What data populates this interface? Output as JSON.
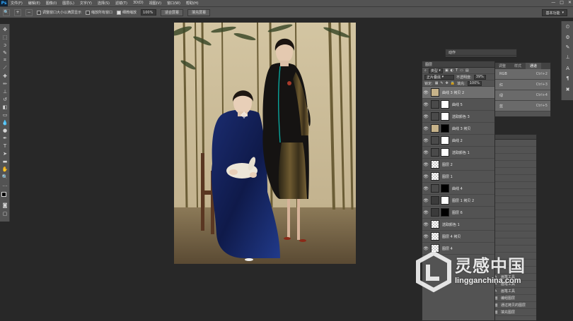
{
  "app": {
    "logo": "Ps"
  },
  "menu": [
    "文件(F)",
    "编辑(E)",
    "图像(I)",
    "图层(L)",
    "文字(Y)",
    "选择(S)",
    "滤镜(T)",
    "3D(D)",
    "视图(V)",
    "窗口(W)",
    "帮助(H)"
  ],
  "window_controls": [
    "—",
    "□",
    "✕"
  ],
  "options": {
    "resize_label": "调整窗口大小以满屏显示",
    "zoom_all_label": "缩放所有窗口",
    "scrubby_label": "细微缩放",
    "scrubby_checked": true,
    "zoom_value": "100%",
    "fit_screen": "适合屏幕",
    "fill_screen": "填充屏幕",
    "workspace": "基本功能"
  },
  "actions_panel": {
    "title": "动作"
  },
  "channels": {
    "tabs": [
      "调整",
      "样式",
      "通道"
    ],
    "active_tab": 2,
    "rows": [
      {
        "name": "RGB",
        "shortcut": "Ctrl+2"
      },
      {
        "name": "红",
        "shortcut": "Ctrl+3"
      },
      {
        "name": "绿",
        "shortcut": "Ctrl+4"
      },
      {
        "name": "蓝",
        "shortcut": "Ctrl+5"
      }
    ]
  },
  "history": {
    "rows": [
      {
        "icon": "brush-icon",
        "name": "画笔工具"
      },
      {
        "icon": "brush-icon",
        "name": "画笔工具"
      },
      {
        "icon": "brush-icon",
        "name": "画笔工具"
      },
      {
        "icon": "layer-icon",
        "name": "编组图层"
      },
      {
        "icon": "layer-icon",
        "name": "通过拷贝的图层"
      },
      {
        "icon": "layer-icon",
        "name": "填充图层"
      }
    ]
  },
  "layers": {
    "title": "图层",
    "filter_kind": "类型",
    "blend_mode": "正片叠底",
    "opacity_label": "不透明度:",
    "opacity_value": "39%",
    "lock_label": "锁定:",
    "fill_label": "填充:",
    "fill_value": "100%",
    "items": [
      {
        "name": "曲线 3 拷贝 2",
        "thumb": "photo",
        "mask": "none",
        "selected": true
      },
      {
        "name": "曲线 5",
        "thumb": "adj",
        "mask": "white",
        "selected": false
      },
      {
        "name": "选取颜色 3",
        "thumb": "adj",
        "mask": "white",
        "selected": false
      },
      {
        "name": "曲线 3 拷贝",
        "thumb": "photo",
        "mask": "black",
        "selected": false
      },
      {
        "name": "曲线 2",
        "thumb": "adj",
        "mask": "white",
        "selected": false
      },
      {
        "name": "选取颜色 1",
        "thumb": "adj",
        "mask": "white",
        "selected": false
      },
      {
        "name": "图层 2",
        "thumb": "checker",
        "mask": "none",
        "selected": false
      },
      {
        "name": "图层 1",
        "thumb": "checker",
        "mask": "none",
        "selected": false
      },
      {
        "name": "曲线 4",
        "thumb": "adj",
        "mask": "blackspot",
        "selected": false
      },
      {
        "name": "图层 1 拷贝 2",
        "thumb": "person",
        "mask": "whitespot",
        "selected": false
      },
      {
        "name": "图层 6",
        "thumb": "person",
        "mask": "blackspot",
        "selected": false
      },
      {
        "name": "选取颜色 1",
        "thumb": "checker",
        "mask": "none",
        "selected": false
      },
      {
        "name": "图层 4 拷贝",
        "thumb": "checker",
        "mask": "none",
        "selected": false
      },
      {
        "name": "图层 4",
        "thumb": "checker",
        "mask": "none",
        "selected": false
      }
    ]
  },
  "watermark": {
    "title": "灵感中国",
    "url": "lingganchina.com"
  },
  "colors": {
    "ui_bg": "#535353",
    "canvas_bg": "#282828",
    "panel_header": "#424242",
    "accent_blue": "#31a8ff"
  }
}
